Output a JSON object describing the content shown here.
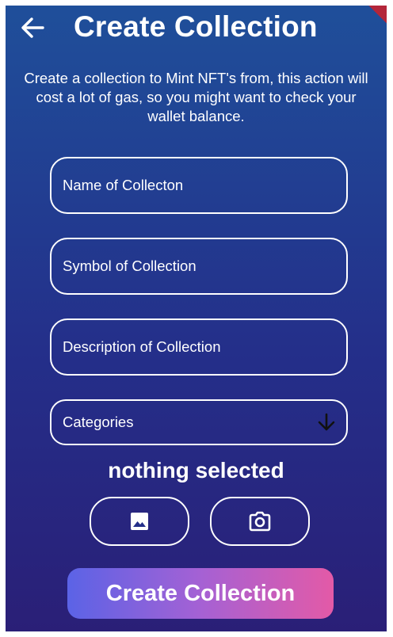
{
  "appbar": {
    "title": "Create Collection"
  },
  "intro_text": "Create a collection to Mint NFT's from, this action will cost a lot of gas, so you might want to check your wallet balance.",
  "form": {
    "name_placeholder": "Name of Collecton",
    "symbol_placeholder": "Symbol of Collection",
    "description_placeholder": "Description of Collection",
    "categories_label": "Categories"
  },
  "selection_status": "nothing selected",
  "submit_label": "Create Collection",
  "icons": {
    "back": "arrow-left-icon",
    "dropdown": "arrow-down-icon",
    "gallery": "image-icon",
    "camera": "camera-icon"
  },
  "colors": {
    "background_top": "#1f4f9a",
    "background_bottom": "#2a1f77",
    "button_gradient_start": "#5b63e6",
    "button_gradient_end": "#e35aa7",
    "debug_ribbon": "#b3263a"
  }
}
